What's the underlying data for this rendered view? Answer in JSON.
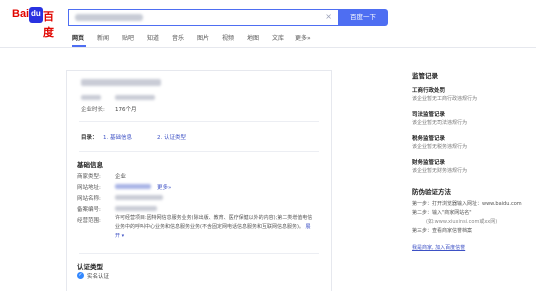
{
  "logo": {
    "left": "Bai",
    "paw": "du",
    "right": "百度"
  },
  "search": {
    "button_label": "百度一下",
    "clear_glyph": "×"
  },
  "tabs": [
    "网页",
    "新闻",
    "贴吧",
    "知道",
    "音乐",
    "图片",
    "视频",
    "地图",
    "文库",
    "更多»"
  ],
  "card": {
    "established_label": "企业时长:",
    "established_value": "176个月",
    "toc_label": "目录：",
    "toc_items": [
      "1. 基础信息",
      "2. 认证类型"
    ],
    "basic_title": "基础信息",
    "fields": [
      {
        "label": "商家类型:",
        "value": "企业"
      },
      {
        "label": "网站地址:",
        "more": "更多»"
      },
      {
        "label": "网站名称:"
      },
      {
        "label": "备案编号:"
      },
      {
        "label": "经营范围:"
      }
    ],
    "scope_text": "许可经营项目:因特网信息服务业务(除出版、教育、医疗保健以外的内容);第二类增值电信业务中的呼叫中心业务和信息服务业务(不含固定网电话信息服务和互联网信息服务)。",
    "scope_more": "展开",
    "auth_title": "认证类型",
    "auth_item": "实名认证"
  },
  "side": {
    "heading": "监管记录",
    "records": [
      {
        "title": "工商行政处罚",
        "desc": "该企业暂无工商行政违规行为"
      },
      {
        "title": "司法监管记录",
        "desc": "该企业暂无司法违规行为"
      },
      {
        "title": "税务监管记录",
        "desc": "该企业暂无税务违规行为"
      },
      {
        "title": "财务监管记录",
        "desc": "该企业暂无财务违规行为"
      }
    ],
    "verify_title": "防伪验证方法",
    "steps": [
      "第一步：打开浏览器输入网址：www.baidu.com",
      "第二步：输入\"商家网站名\"",
      "(如:www.xiuxinsi.com或xx网)",
      "第三步：查看商家信誉档案"
    ],
    "join_link": "我是商家, 加入百度信誉"
  }
}
